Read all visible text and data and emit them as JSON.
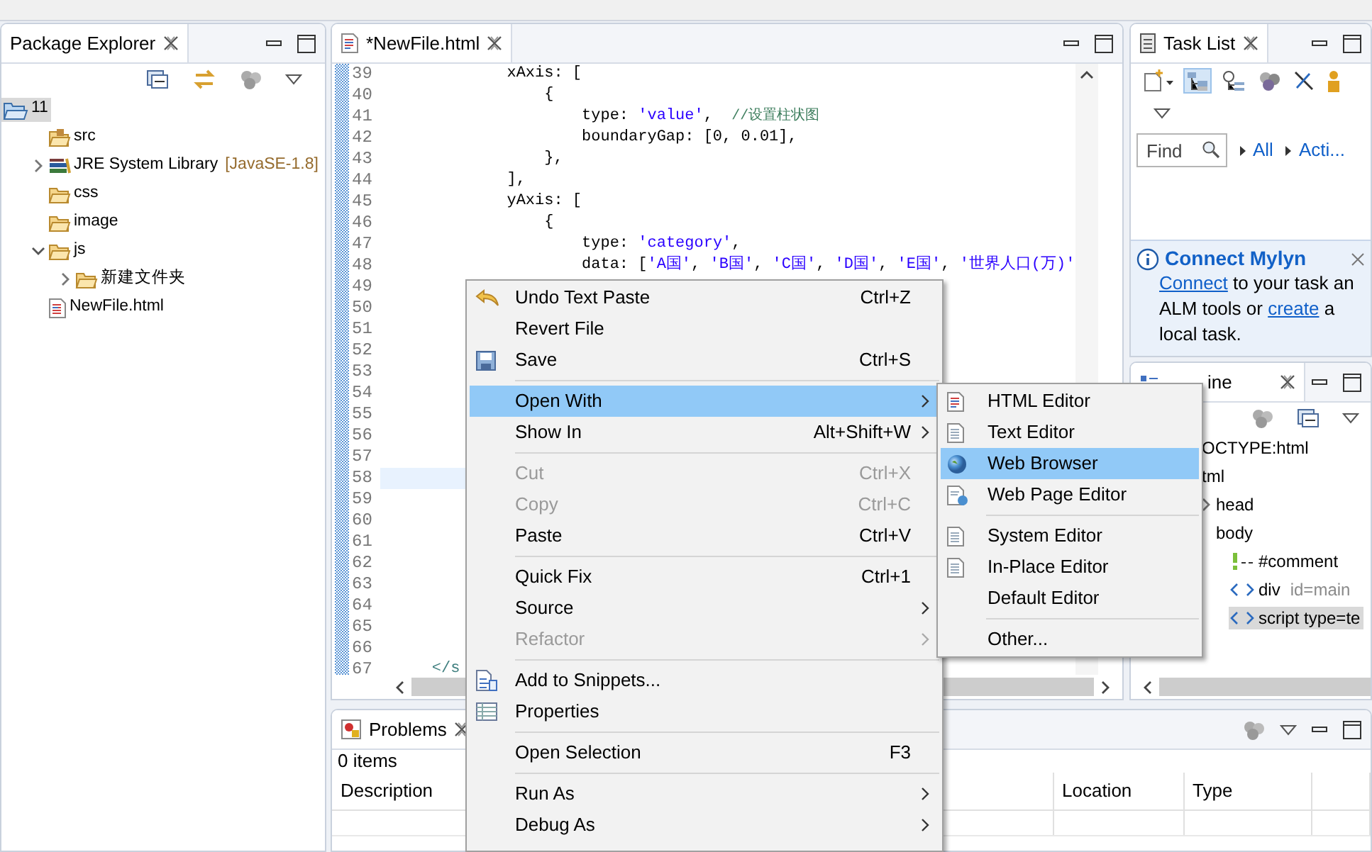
{
  "package_explorer": {
    "title": "Package Explorer",
    "tree": [
      {
        "label": "11",
        "kind": "project",
        "selected": true,
        "children": [
          {
            "label": "src",
            "kind": "source-folder",
            "selected": false
          },
          {
            "label": "JRE System Library",
            "decoration": "[JavaSE-1.8]",
            "kind": "library",
            "expanded": false,
            "selected": false
          },
          {
            "label": "css",
            "kind": "folder",
            "selected": false
          },
          {
            "label": "image",
            "kind": "folder",
            "selected": false
          },
          {
            "label": "js",
            "kind": "folder",
            "expanded": true,
            "selected": false,
            "children": [
              {
                "label": "新建文件夹",
                "kind": "folder",
                "expanded": false,
                "selected": false
              }
            ]
          },
          {
            "label": "NewFile.html",
            "kind": "file",
            "selected": false
          }
        ]
      }
    ]
  },
  "editor": {
    "tab": {
      "label": "*NewFile.html"
    },
    "lines": [
      {
        "number": "39",
        "current": false,
        "segments": [
          {
            "text": "            xAxis: [",
            "kind": "plain"
          }
        ]
      },
      {
        "number": "40",
        "current": false,
        "segments": [
          {
            "text": "                {",
            "kind": "plain"
          }
        ]
      },
      {
        "number": "41",
        "current": false,
        "segments": [
          {
            "text": "                    type: ",
            "kind": "plain"
          },
          {
            "text": "'value'",
            "kind": "string"
          },
          {
            "text": ",  ",
            "kind": "plain"
          },
          {
            "text": "//设置柱状图",
            "kind": "comment"
          }
        ]
      },
      {
        "number": "42",
        "current": false,
        "segments": [
          {
            "text": "                    boundaryGap: [0, 0.01],",
            "kind": "plain"
          }
        ]
      },
      {
        "number": "43",
        "current": false,
        "segments": [
          {
            "text": "                },",
            "kind": "plain"
          }
        ]
      },
      {
        "number": "44",
        "current": false,
        "segments": [
          {
            "text": "            ],",
            "kind": "plain"
          }
        ]
      },
      {
        "number": "45",
        "current": false,
        "segments": [
          {
            "text": "            yAxis: [",
            "kind": "plain"
          }
        ]
      },
      {
        "number": "46",
        "current": false,
        "segments": [
          {
            "text": "                {",
            "kind": "plain"
          }
        ]
      },
      {
        "number": "47",
        "current": false,
        "segments": [
          {
            "text": "                    type: ",
            "kind": "plain"
          },
          {
            "text": "'category'",
            "kind": "string"
          },
          {
            "text": ",",
            "kind": "plain"
          }
        ]
      },
      {
        "number": "48",
        "current": false,
        "segments": [
          {
            "text": "                    data: [",
            "kind": "plain"
          },
          {
            "text": "'A国'",
            "kind": "string"
          },
          {
            "text": ", ",
            "kind": "plain"
          },
          {
            "text": "'B国'",
            "kind": "string"
          },
          {
            "text": ", ",
            "kind": "plain"
          },
          {
            "text": "'C国'",
            "kind": "string"
          },
          {
            "text": ", ",
            "kind": "plain"
          },
          {
            "text": "'D国'",
            "kind": "string"
          },
          {
            "text": ", ",
            "kind": "plain"
          },
          {
            "text": "'E国'",
            "kind": "string"
          },
          {
            "text": ", ",
            "kind": "plain"
          },
          {
            "text": "'世界人口(万)'",
            "kind": "string"
          }
        ]
      },
      {
        "number": "49",
        "current": false
      },
      {
        "number": "50",
        "current": false
      },
      {
        "number": "51",
        "current": false
      },
      {
        "number": "52",
        "current": false
      },
      {
        "number": "53",
        "current": false
      },
      {
        "number": "54",
        "current": false
      },
      {
        "number": "55",
        "current": false
      },
      {
        "number": "56",
        "current": false
      },
      {
        "number": "57",
        "current": false
      },
      {
        "number": "58",
        "current": true
      },
      {
        "number": "59",
        "current": false
      },
      {
        "number": "60",
        "current": false
      },
      {
        "number": "61",
        "current": false
      },
      {
        "number": "62",
        "current": false
      },
      {
        "number": "63",
        "current": false
      },
      {
        "number": "64",
        "current": false
      },
      {
        "number": "65",
        "current": false
      },
      {
        "number": "66",
        "current": false
      },
      {
        "number": "67",
        "current": false,
        "segments": [
          {
            "text": "    </s",
            "kind": "tag"
          }
        ]
      }
    ]
  },
  "task_list": {
    "title": "Task List",
    "toggles": [
      {
        "selected": true
      },
      {
        "selected": false
      }
    ],
    "find": {
      "placeholder": "Find"
    },
    "filters": [
      {
        "label": "All"
      },
      {
        "label": "Acti..."
      }
    ],
    "mylyn": {
      "title": "Connect Mylyn",
      "lines": [
        [
          {
            "text": "Connect",
            "link": true
          },
          {
            "text": " to your task an",
            "link": false
          }
        ],
        [
          {
            "text": "ALM tools or ",
            "link": false
          },
          {
            "text": "create",
            "link": true
          },
          {
            "text": " a",
            "link": false
          }
        ],
        [
          {
            "text": "local task.",
            "link": false
          }
        ]
      ]
    }
  },
  "outline": {
    "title": "ine",
    "tree": [
      {
        "label": "OCTYPE:html",
        "selected": false
      },
      {
        "label": "tml",
        "selected": false,
        "children": [
          {
            "label": "head",
            "expanded": false,
            "selected": false
          },
          {
            "label": "body",
            "selected": false,
            "children": [
              {
                "label": "#comment",
                "kind": "comment",
                "selected": false
              },
              {
                "label": "div",
                "decoration": "id=main",
                "kind": "element",
                "selected": false
              },
              {
                "label": "script type=te",
                "kind": "element",
                "selected": true
              }
            ]
          }
        ]
      }
    ]
  },
  "problems": {
    "title": "Problems",
    "count": "0 items",
    "columns": [
      "Description",
      "Location",
      "Type"
    ]
  },
  "context_menu": {
    "items": [
      {
        "kind": "item",
        "label": "Undo Text Paste",
        "shortcut": "Ctrl+Z",
        "has_submenu": false,
        "disabled": false,
        "selected": false
      },
      {
        "kind": "item",
        "label": "Revert File",
        "has_submenu": false,
        "disabled": false,
        "selected": false
      },
      {
        "kind": "item",
        "label": "Save",
        "shortcut": "Ctrl+S",
        "has_submenu": false,
        "disabled": false,
        "selected": false
      },
      {
        "kind": "separator"
      },
      {
        "kind": "item",
        "label": "Open With",
        "has_submenu": true,
        "disabled": false,
        "selected": true
      },
      {
        "kind": "item",
        "label": "Show In",
        "shortcut": "Alt+Shift+W",
        "has_submenu": true,
        "disabled": false,
        "selected": false
      },
      {
        "kind": "separator"
      },
      {
        "kind": "item",
        "label": "Cut",
        "shortcut": "Ctrl+X",
        "has_submenu": false,
        "disabled": true,
        "selected": false
      },
      {
        "kind": "item",
        "label": "Copy",
        "shortcut": "Ctrl+C",
        "has_submenu": false,
        "disabled": true,
        "selected": false
      },
      {
        "kind": "item",
        "label": "Paste",
        "shortcut": "Ctrl+V",
        "has_submenu": false,
        "disabled": false,
        "selected": false
      },
      {
        "kind": "separator"
      },
      {
        "kind": "item",
        "label": "Quick Fix",
        "shortcut": "Ctrl+1",
        "has_submenu": false,
        "disabled": false,
        "selected": false
      },
      {
        "kind": "item",
        "label": "Source",
        "has_submenu": true,
        "disabled": false,
        "selected": false
      },
      {
        "kind": "item",
        "label": "Refactor",
        "has_submenu": true,
        "disabled": true,
        "selected": false
      },
      {
        "kind": "separator"
      },
      {
        "kind": "item",
        "label": "Add to Snippets...",
        "has_submenu": false,
        "disabled": false,
        "selected": false
      },
      {
        "kind": "item",
        "label": "Properties",
        "has_submenu": false,
        "disabled": false,
        "selected": false
      },
      {
        "kind": "separator"
      },
      {
        "kind": "item",
        "label": "Open Selection",
        "shortcut": "F3",
        "has_submenu": false,
        "disabled": false,
        "selected": false
      },
      {
        "kind": "separator"
      },
      {
        "kind": "item",
        "label": "Run As",
        "has_submenu": true,
        "disabled": false,
        "selected": false
      },
      {
        "kind": "item",
        "label": "Debug As",
        "has_submenu": true,
        "disabled": false,
        "selected": false
      }
    ]
  },
  "open_with_menu": {
    "items": [
      {
        "kind": "item",
        "label": "HTML Editor",
        "selected": false
      },
      {
        "kind": "item",
        "label": "Text Editor",
        "selected": false
      },
      {
        "kind": "item",
        "label": "Web Browser",
        "selected": true
      },
      {
        "kind": "item",
        "label": "Web Page Editor",
        "selected": false
      },
      {
        "kind": "separator"
      },
      {
        "kind": "item",
        "label": "System Editor",
        "selected": false
      },
      {
        "kind": "item",
        "label": "In-Place Editor",
        "selected": false
      },
      {
        "kind": "item",
        "label": "Default Editor",
        "selected": false
      },
      {
        "kind": "separator"
      },
      {
        "kind": "item",
        "label": "Other...",
        "selected": false
      }
    ]
  }
}
